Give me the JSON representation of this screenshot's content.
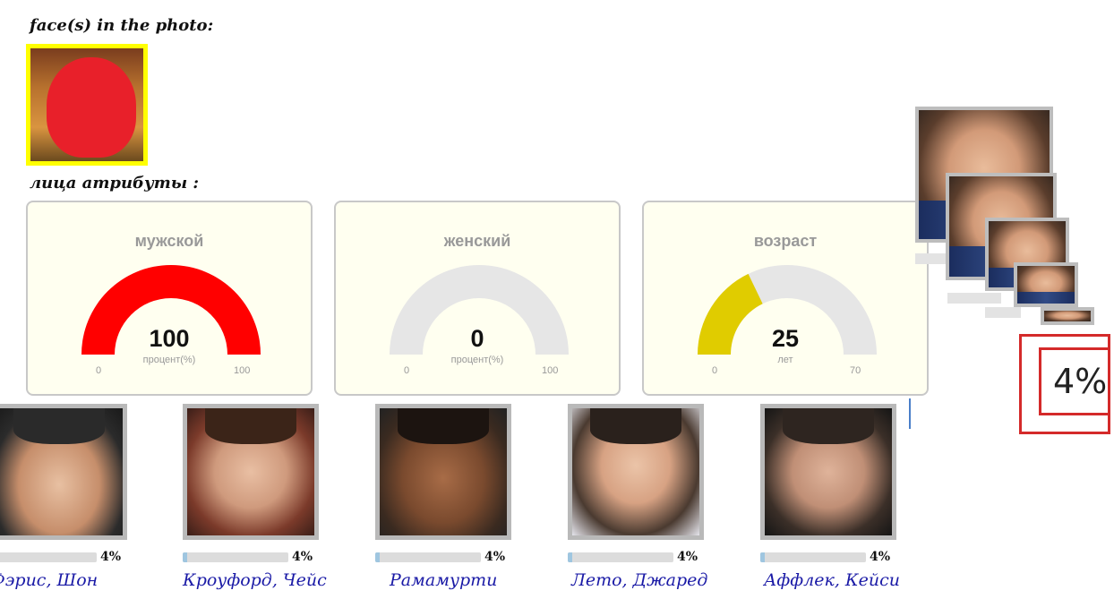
{
  "sections": {
    "faces_title": "face(s) in the photo:",
    "attributes_title": "лица атрибуты :"
  },
  "gauges": [
    {
      "label": "мужской",
      "value": "100",
      "unit": "процент(%)",
      "min": "0",
      "max": "100",
      "fraction": 1.0,
      "color": "#ff0000"
    },
    {
      "label": "женский",
      "value": "0",
      "unit": "процент(%)",
      "min": "0",
      "max": "100",
      "fraction": 0.0,
      "color": "#ff0000"
    },
    {
      "label": "возраст",
      "value": "25",
      "unit": "лет",
      "min": "0",
      "max": "70",
      "fraction": 0.357,
      "color": "#e0cc00"
    }
  ],
  "matches": [
    {
      "name": "Фэрис, Шон",
      "percent": "4%",
      "similarity": 0.04
    },
    {
      "name": "Кроуфорд, Чейс",
      "percent": "4%",
      "similarity": 0.04
    },
    {
      "name": "Рамамурти",
      "percent": "4%",
      "similarity": 0.04
    },
    {
      "name": "Лето, Джаред",
      "percent": "4%",
      "similarity": 0.04
    },
    {
      "name": "Аффлек, Кейси",
      "percent": "4%",
      "similarity": 0.04
    }
  ],
  "zoom_overlay": {
    "percent": "4%"
  },
  "colors": {
    "highlight_border": "#ffff00",
    "redaction": "#e8202a",
    "link": "#1a1aa6",
    "zoom_border": "#d42a2a"
  }
}
